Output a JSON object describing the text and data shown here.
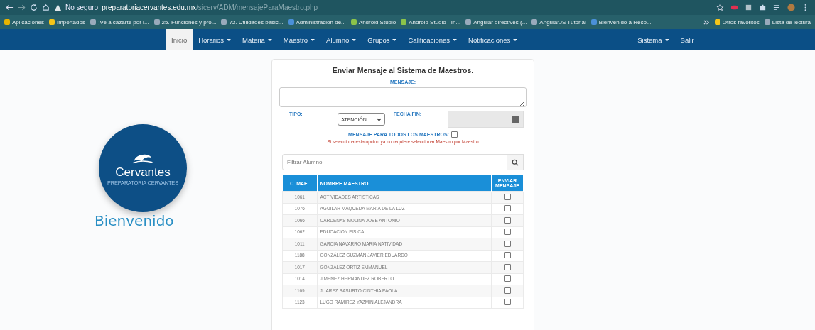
{
  "browser": {
    "security": "No seguro",
    "url_host": "preparatoriacervantes.edu.mx",
    "url_path": "/sicerv/ADM/mensajeParaMaestro.php"
  },
  "bookmarks": [
    {
      "label": "Aplicaciones",
      "kind": "apps"
    },
    {
      "label": "Importados",
      "kind": "folder"
    },
    {
      "label": "¡Ve a cazarte por l...",
      "kind": "page"
    },
    {
      "label": "25. Funciones y pro...",
      "kind": "page"
    },
    {
      "label": "72. Utilidades básic...",
      "kind": "page"
    },
    {
      "label": "Administración de...",
      "kind": "globe"
    },
    {
      "label": "Android Studio",
      "kind": "android"
    },
    {
      "label": "Android Studio - In...",
      "kind": "android"
    },
    {
      "label": "Angular directives (...",
      "kind": "page"
    },
    {
      "label": "AngularJS Tutorial",
      "kind": "page"
    },
    {
      "label": "Bienvenido a Reco...",
      "kind": "globe"
    }
  ],
  "bookmarks_right": [
    {
      "label": "Otros favoritos",
      "kind": "folder"
    },
    {
      "label": "Lista de lectura",
      "kind": "page"
    }
  ],
  "nav": [
    {
      "label": "Inicio",
      "dropdown": false,
      "selected": true
    },
    {
      "label": "Horarios",
      "dropdown": true,
      "selected": false
    },
    {
      "label": "Materia",
      "dropdown": true,
      "selected": false
    },
    {
      "label": "Maestro",
      "dropdown": true,
      "selected": false
    },
    {
      "label": "Alumno",
      "dropdown": true,
      "selected": false
    },
    {
      "label": "Grupos",
      "dropdown": true,
      "selected": false
    },
    {
      "label": "Calificaciones",
      "dropdown": true,
      "selected": false
    },
    {
      "label": "Notificaciones",
      "dropdown": true,
      "selected": false
    }
  ],
  "nav_right": [
    {
      "label": "Sistema",
      "dropdown": true,
      "selected": false
    },
    {
      "label": "Salir",
      "dropdown": false,
      "selected": false
    }
  ],
  "logo": {
    "name": "Cervantes",
    "tagline": "PREPARATORIA CERVANTES",
    "welcome": "Bienvenido"
  },
  "form": {
    "title": "Enviar Mensaje al Sistema de Maestros.",
    "message_label": "MENSAJE:",
    "type_label": "TIPO:",
    "type_value": "ATENCIÓN",
    "date_label": "FECHA FIN:",
    "all_label": "MENSAJE PARA TODOS LOS MAESTROS:",
    "all_checked": false,
    "note": "Si selecciona esta opcion ya no requiere seleccionar Maestro por Maestro",
    "filter_placeholder": "Filtrar Alumno"
  },
  "table": {
    "columns": [
      "C. MAE.",
      "NOMBRE MAESTRO",
      "ENVIAR MENSAJE"
    ],
    "rows": [
      {
        "id": "1061",
        "name": "ACTIVIDADES ARTISTICAS",
        "checked": false
      },
      {
        "id": "1076",
        "name": "AGUILAR MAQUEDA MARIA DE LA LUZ",
        "checked": false
      },
      {
        "id": "1066",
        "name": "CARDENAS MOLINA JOSE ANTONIO",
        "checked": false
      },
      {
        "id": "1062",
        "name": "EDUCACION FISICA",
        "checked": false
      },
      {
        "id": "1011",
        "name": "GARCIA NAVARRO MARIA NATIVIDAD",
        "checked": false
      },
      {
        "id": "1188",
        "name": "GONZÁLEZ GUZMÁN JAVIER EDUARDO",
        "checked": false
      },
      {
        "id": "1017",
        "name": "GONZALEZ ORTIZ EMMANUEL",
        "checked": false
      },
      {
        "id": "1014",
        "name": "JIMENEZ HERNANDEZ ROBERTO",
        "checked": false
      },
      {
        "id": "1169",
        "name": "JUAREZ BASURTO CINTHIA PAOLA",
        "checked": false
      },
      {
        "id": "1123",
        "name": "LUGO RAMIREZ YAZMIN ALEJANDRA",
        "checked": false
      }
    ]
  }
}
